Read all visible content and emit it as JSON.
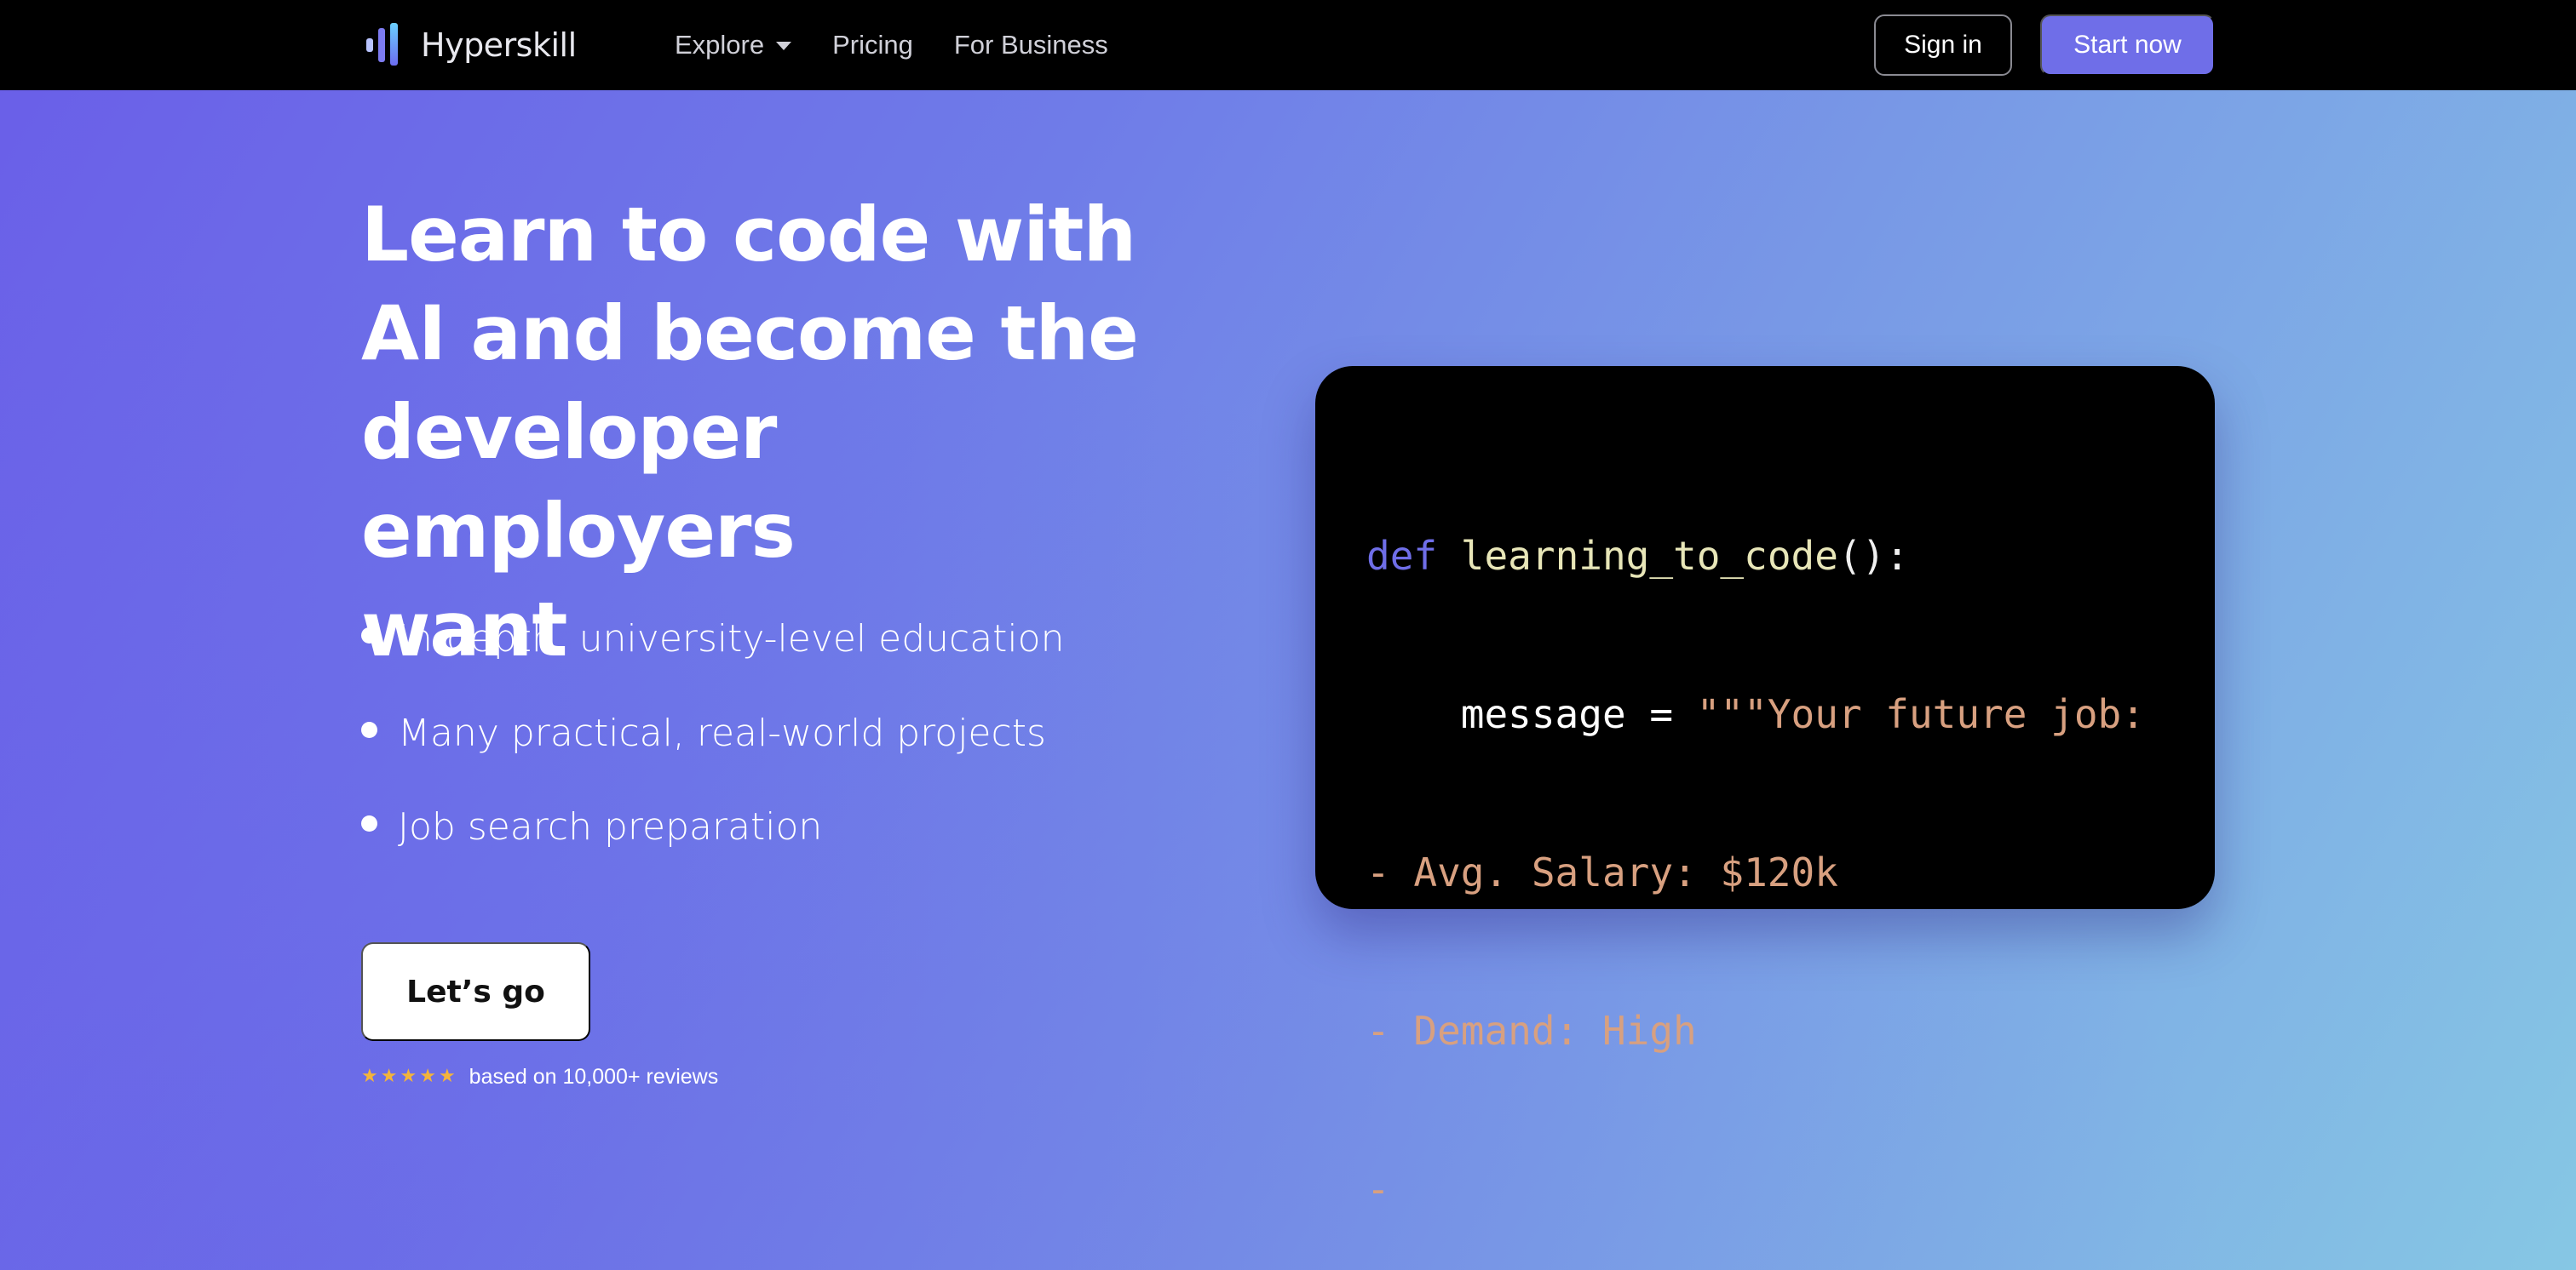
{
  "nav": {
    "logo_text": "Hyperskill",
    "links": [
      {
        "label": "Explore",
        "has_dropdown": true
      },
      {
        "label": "Pricing"
      },
      {
        "label": "For Business"
      }
    ],
    "signin_label": "Sign in",
    "start_label": "Start now"
  },
  "hero": {
    "title_lines": [
      "Learn to code with",
      "AI and become the",
      "developer employers",
      "want"
    ],
    "features": [
      "In-depth, university-level education",
      "Many practical, real-world projects",
      "Job search preparation"
    ],
    "cta_label": "Let’s go",
    "rating_stars": 5,
    "rating_text": "based on 10,000+ reviews"
  },
  "code": {
    "line1": {
      "keyword": "def",
      "name": "learning_to_code",
      "punc": "():"
    },
    "line2": {
      "indent": "    ",
      "var": "message = ",
      "string": "\"\"\"Your future job:"
    },
    "line3": "- Avg. Salary: $120k",
    "line4": "- Demand: High",
    "line5": "-"
  },
  "colors": {
    "accent": "#6f6ee8",
    "star": "#f3b43c",
    "code_string": "#d8a080",
    "code_function": "#e8e6b8"
  }
}
